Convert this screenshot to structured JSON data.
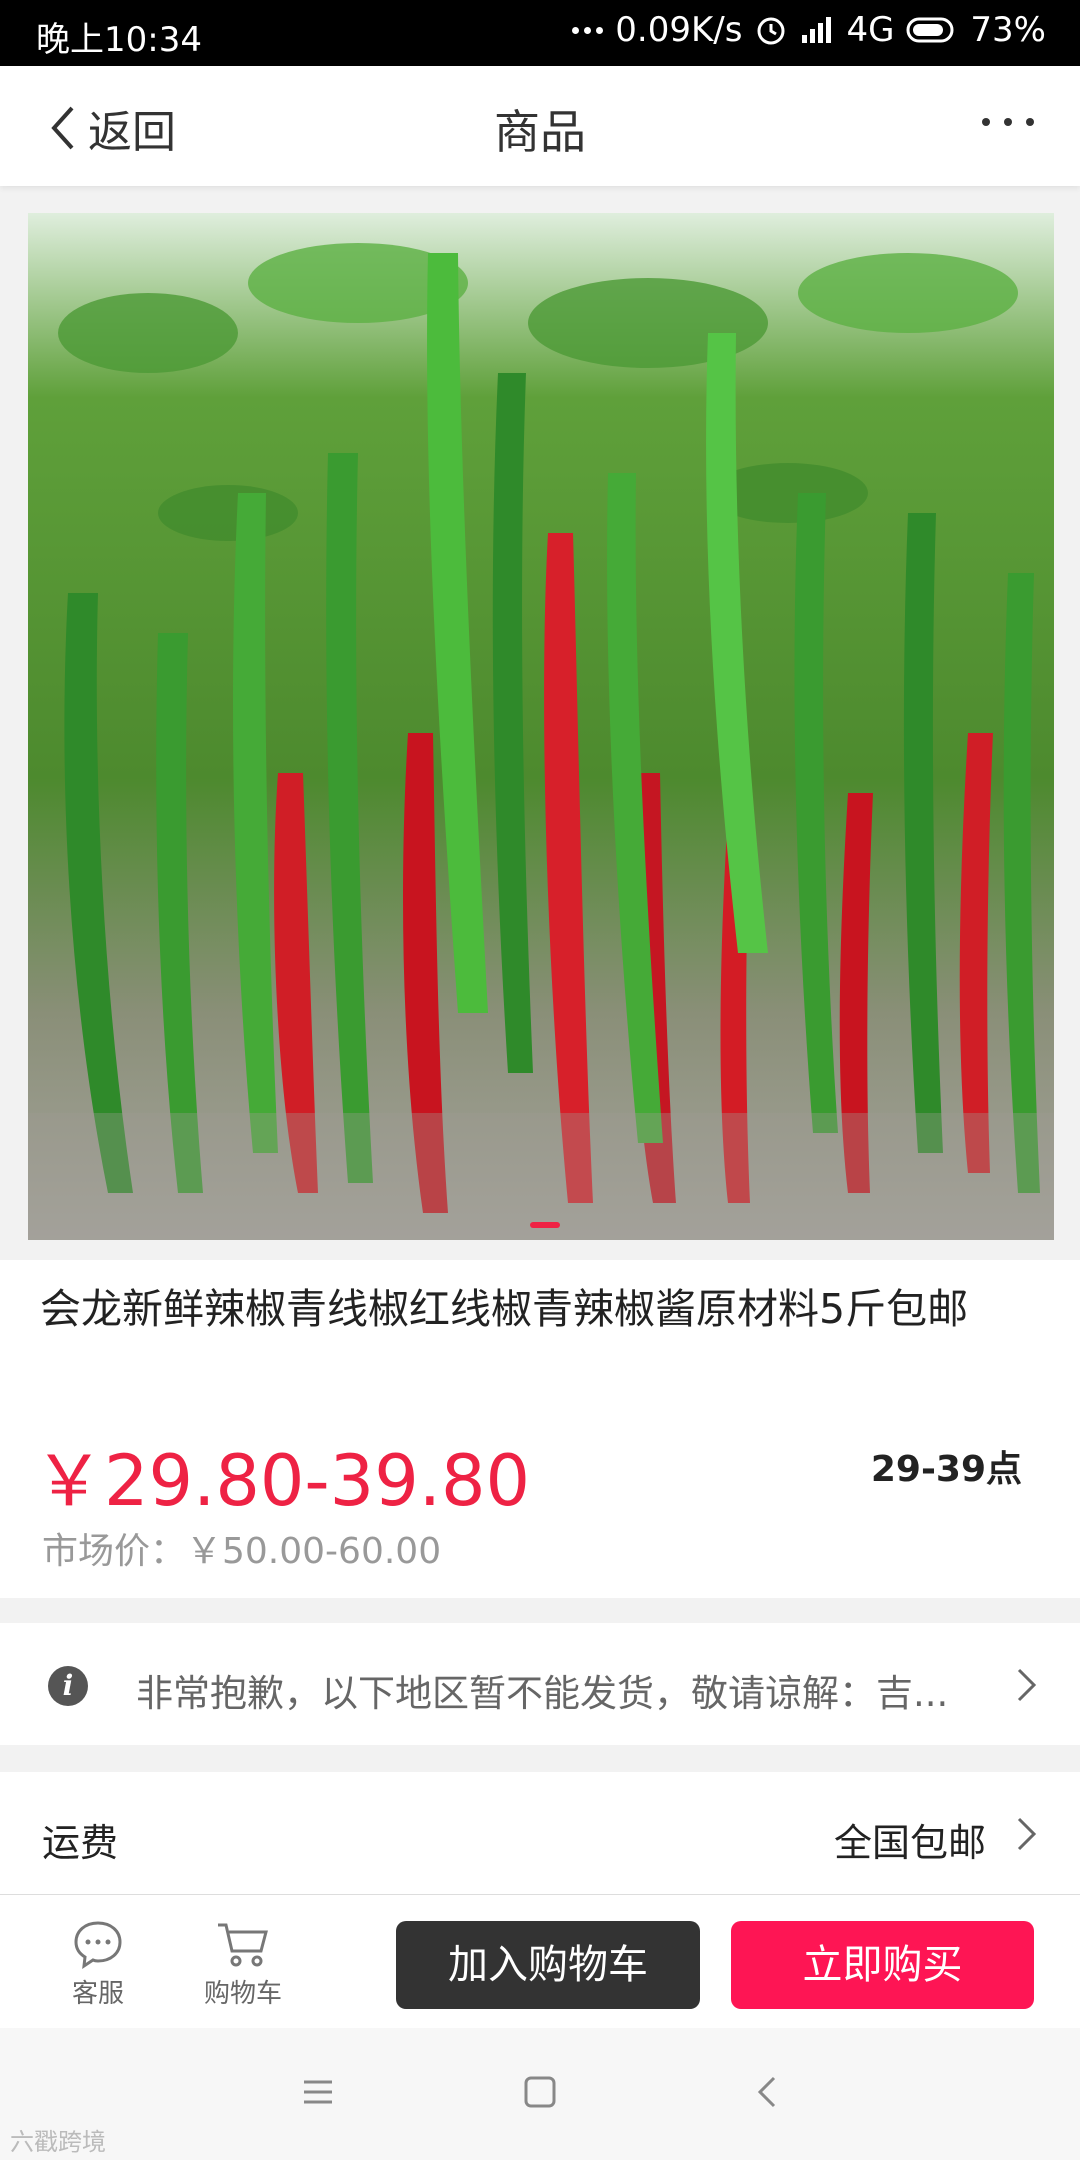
{
  "status_bar": {
    "time": "晚上10:34",
    "speed": "0.09K/s",
    "network": "4G",
    "battery": "73%"
  },
  "header": {
    "back_label": "返回",
    "title": "商品"
  },
  "product": {
    "title": "会龙新鲜辣椒青线椒红线椒青辣椒酱原材料5斤包邮",
    "price": "￥29.80-39.80",
    "points": "29-39点",
    "market_price": "市场价：￥50.00-60.00"
  },
  "notice": {
    "text": "非常抱歉，以下地区暂不能发货，敬请谅解：吉..."
  },
  "shipping": {
    "label": "运费",
    "value": "全国包邮"
  },
  "bottom_bar": {
    "service_label": "客服",
    "cart_label": "购物车",
    "add_to_cart": "加入购物车",
    "buy_now": "立即购买"
  },
  "watermark": "六戳跨境",
  "colors": {
    "accent": "#fe1554",
    "price": "#ee2244",
    "dark_button": "#333333"
  }
}
